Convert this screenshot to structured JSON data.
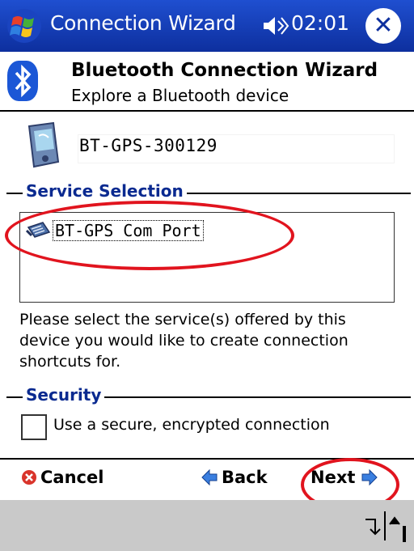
{
  "titlebar": {
    "app_title": "Connection Wizard",
    "clock": "02:01",
    "icons": [
      "windows-logo-icon",
      "speaker-icon",
      "close-icon"
    ],
    "close_glyph": "✕"
  },
  "header": {
    "title": "Bluetooth Connection Wizard",
    "subtitle": "Explore a Bluetooth device",
    "icon": "bluetooth-icon"
  },
  "device": {
    "name": "BT-GPS-300129",
    "icon": "pda-device-icon"
  },
  "service_selection": {
    "label": "Service Selection",
    "items": [
      {
        "label": "BT-GPS Com Port",
        "icon": "serial-port-icon"
      }
    ],
    "instructions": "Please select the service(s) offered by this device you would like to create connection shortcuts for."
  },
  "security": {
    "label": "Security",
    "checkbox_label": "Use a secure, encrypted connection",
    "checked": false
  },
  "buttons": {
    "cancel": "Cancel",
    "back": "Back",
    "next": "Next"
  },
  "colors": {
    "titlebar": "#0d2f9e",
    "group_label": "#0a2a90",
    "annotation": "#e1141e",
    "menubar": "#c9c9c9"
  }
}
